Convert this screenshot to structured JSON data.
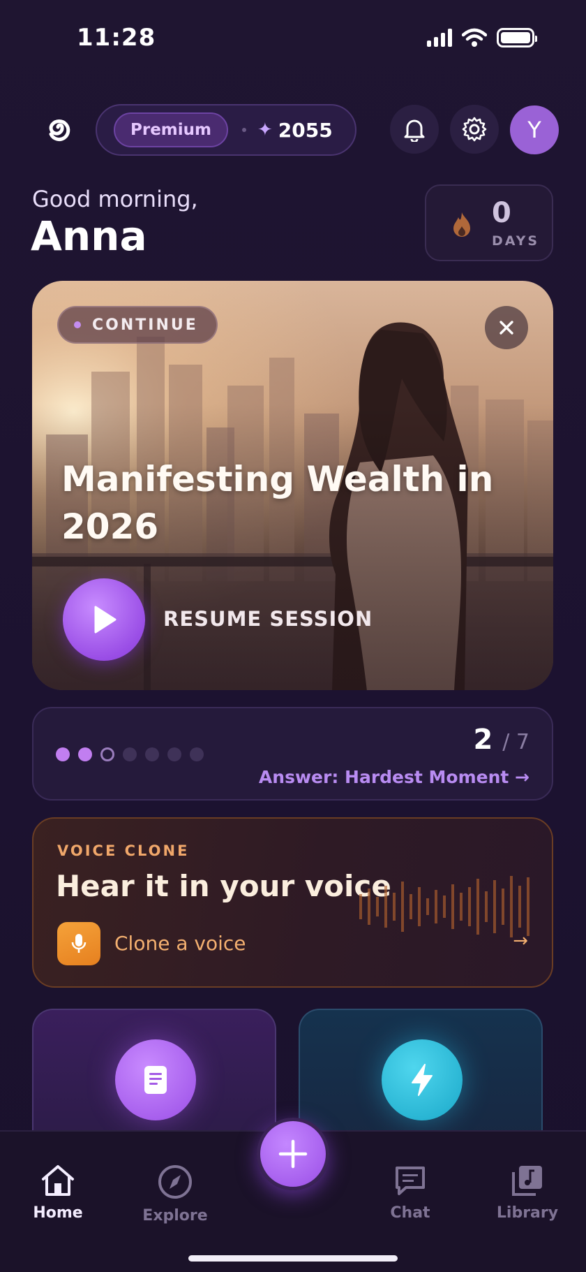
{
  "status_bar": {
    "time": "11:28"
  },
  "header": {
    "plan_label": "Premium",
    "credits": "2055",
    "avatar_initial": "Y"
  },
  "greeting": {
    "salutation": "Good morning,",
    "name": "Anna"
  },
  "streak": {
    "count": "0",
    "unit": "DAYS"
  },
  "continue_card": {
    "badge": "CONTINUE",
    "title": "Manifesting Wealth in 2026",
    "resume_label": "RESUME SESSION"
  },
  "session_progress": {
    "current_step": "2",
    "total_steps": "/ 7",
    "next_action": "Answer: Hardest Moment →",
    "step_states": [
      "done",
      "done",
      "current",
      "todo",
      "todo",
      "todo",
      "todo"
    ]
  },
  "voice_clone": {
    "eyebrow": "VOICE CLONE",
    "title": "Hear it in your voice",
    "cta": "Clone a voice",
    "arrow": "→"
  },
  "feature_tiles": [
    {
      "icon": "journal-icon",
      "color": "#9a4ee6"
    },
    {
      "icon": "lightning-icon",
      "color": "#1aa8c9"
    }
  ],
  "nav": {
    "items": [
      {
        "label": "Home",
        "icon": "home-icon",
        "active": true
      },
      {
        "label": "Explore",
        "icon": "compass-icon",
        "active": false
      },
      {
        "label": "Chat",
        "icon": "chat-icon",
        "active": false
      },
      {
        "label": "Library",
        "icon": "library-icon",
        "active": false
      }
    ],
    "fab_icon": "plus-icon"
  },
  "colors": {
    "background": "#1e1430",
    "accent_purple": "#9a4ee6",
    "accent_orange": "#f4b070",
    "accent_cyan": "#1aa8c9"
  }
}
